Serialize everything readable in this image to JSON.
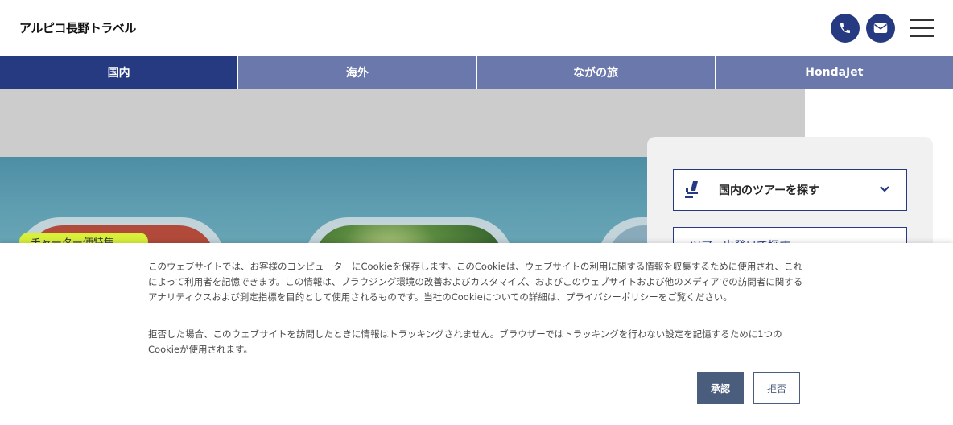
{
  "header": {
    "logo_text": "アルピコ長野トラベル",
    "phone_icon": "phone-icon",
    "mail_icon": "mail-icon",
    "menu_icon": "hamburger-menu-icon",
    "accent_color": "#263a82"
  },
  "nav": {
    "tabs": [
      {
        "label": "国内",
        "active": true
      },
      {
        "label": "海外",
        "active": false
      },
      {
        "label": "ながの旅",
        "active": false
      },
      {
        "label": "HondaJet",
        "active": false
      }
    ]
  },
  "hero": {
    "badge_label": "チャーター便特集"
  },
  "search": {
    "domestic_tour_label": "国内のツアーを探す",
    "domestic_tour_icon": "airplane-seat-icon",
    "second_option_label": "ツアー出発日で探す"
  },
  "cookie": {
    "paragraph1": "このウェブサイトでは、お客様のコンピューターにCookieを保存します。このCookieは、ウェブサイトの利用に関する情報を収集するために使用され、これによって利用者を記憶できます。この情報は、ブラウジング環境の改善およびカスタマイズ、およびこのウェブサイトおよび他のメディアでの訪問者に関するアナリティクスおよび測定指標を目的として使用されるものです。当社のCookieについての詳細は、プライバシーポリシーをご覧ください。",
    "paragraph2": "拒否した場合、このウェブサイトを訪問したときに情報はトラッキングされません。ブラウザーではトラッキングを行わない設定を記憶するために1つのCookieが使用されます。",
    "accept_label": "承認",
    "reject_label": "拒否"
  }
}
